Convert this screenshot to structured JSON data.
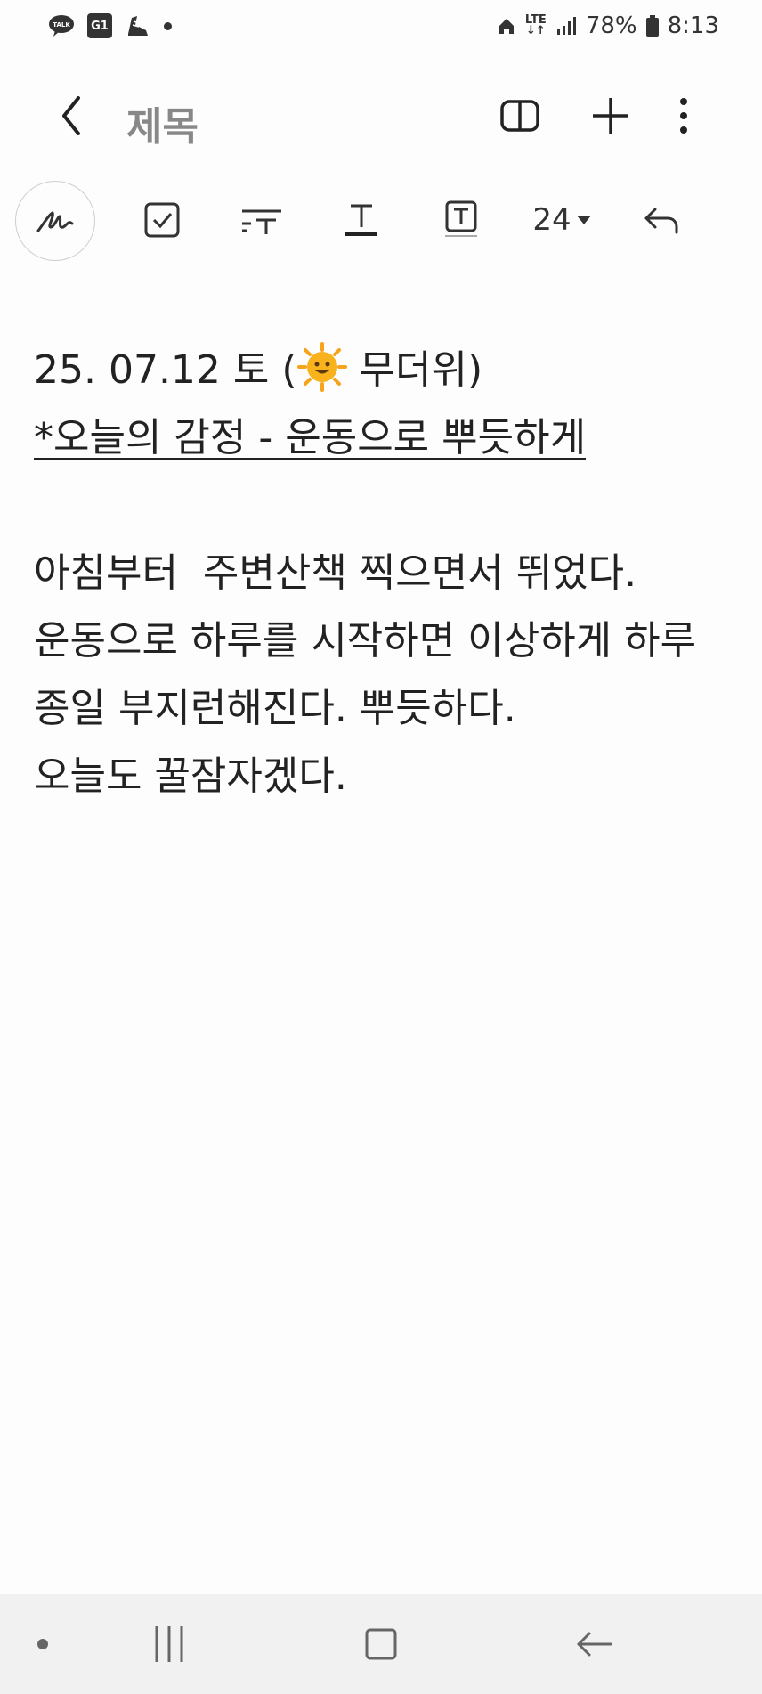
{
  "status_bar": {
    "battery": "78%",
    "time": "8:13",
    "network": "LTE",
    "icons": [
      "talk-icon",
      "g1-icon",
      "sneaker-icon",
      "notification-dot-icon",
      "home-icon",
      "lte-icon",
      "signal-icon",
      "battery-icon"
    ]
  },
  "app_bar": {
    "title": "제목",
    "icons": [
      "back-icon",
      "book-view-icon",
      "add-icon",
      "more-icon"
    ]
  },
  "toolbar": {
    "font_size": "24",
    "icons": [
      "pen-icon",
      "checkbox-icon",
      "text-style-icon",
      "underline-text-icon",
      "text-box-icon",
      "undo-icon"
    ]
  },
  "note": {
    "line1_prefix": "25. 07.12 토 (",
    "line1_suffix": " 무더위)",
    "line1_emoji": "sun-emoji",
    "line2": "*오늘의 감정 - 운동으로 뿌듯하게",
    "body": [
      "아침부터  주변산책 찍으면서 뛰었다.",
      "운동으로 하루를 시작하면 이상하게 하루",
      "종일 부지런해진다. 뿌듯하다.",
      "오늘도 꿀잠자겠다."
    ]
  },
  "nav_bar": {
    "icons": [
      "dot-icon",
      "recents-icon",
      "home-button-icon",
      "back-nav-icon"
    ]
  },
  "colors": {
    "background": "#fdfdfe",
    "text": "#222222",
    "title_gray": "#888888",
    "nav_bg": "#f1f1f2",
    "sun_yellow": "#f7b21c"
  }
}
